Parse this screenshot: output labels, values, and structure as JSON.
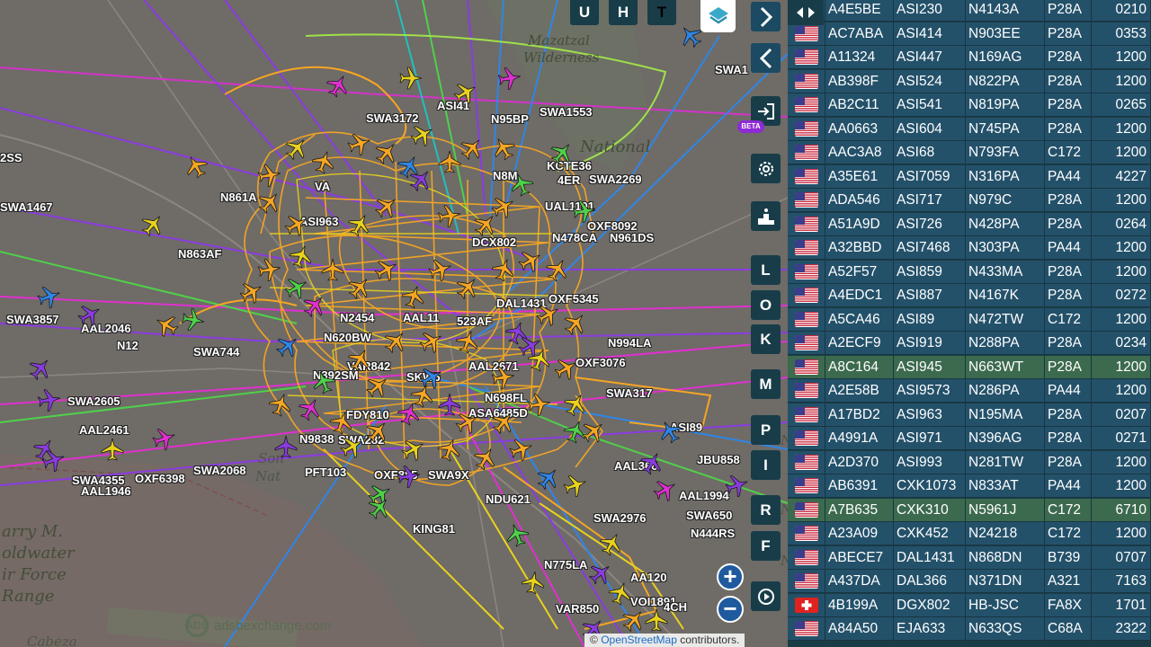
{
  "map": {
    "places": [
      "Mazatzal",
      "Wilderness",
      "National",
      "arry M.",
      "oldwater",
      "ir Force",
      "Range",
      "Son",
      "Nat",
      "Cabeza",
      "N",
      "N",
      "N"
    ],
    "callsigns": [
      "SWA3172",
      "ASI41",
      "N95BP",
      "SWA1553",
      "SWA1",
      "2SS",
      "SWA1467",
      "N861A",
      "ASI963",
      "N863AF",
      "KCTE36",
      "SWA2269",
      "OXF8092",
      "N961DS",
      "N478CA",
      "UAL1101",
      "DCX802",
      "SWA3857",
      "AAL2046",
      "N12",
      "SWA744",
      "N392SM",
      "VAR842",
      "SWA2605",
      "AAL2461",
      "SWA4355",
      "OXF6398",
      "AAL1946",
      "SWA2068",
      "PFT103",
      "FDY810",
      "SWA282",
      "N9838",
      "OXF885",
      "SWA9X",
      "N994LA",
      "OXF3076",
      "SWA317",
      "AAL2671",
      "N698FL",
      "ASA6485D",
      "JBU858",
      "AAL1994",
      "SWA650",
      "N444RS",
      "KING81",
      "N775LA",
      "AA120",
      "VOI1891",
      "VAR850",
      "SWA2976",
      "ASI89",
      "OXF5345",
      "N2454",
      "AAL11",
      "523AF",
      "VA",
      "NDU621",
      "N620BW",
      "SKW6",
      "DAL1431",
      "N8M",
      "4ER",
      "AAL366",
      "4CH"
    ],
    "logo_text": "adsbexchange.com",
    "logo_mark": "ADS",
    "attribution_prefix": "©",
    "attribution_link": "OpenStreetMap",
    "attribution_suffix": "contributors."
  },
  "controls": {
    "lang_u": "U",
    "lang_h": "H",
    "lang_t": "T",
    "next": "›",
    "prev": "‹",
    "beta": "BETA",
    "letters": [
      "L",
      "O",
      "K",
      "M",
      "P",
      "I",
      "R",
      "F"
    ],
    "zoom_in": "+",
    "zoom_out": "−"
  },
  "sidebar": {
    "toggle_icon": "◂▸",
    "rows": [
      {
        "flag": "US",
        "hex": "A4E5BE",
        "callsign": "ASI230",
        "reg": "N4143A",
        "type": "P28A",
        "alt": "0210"
      },
      {
        "flag": "US",
        "hex": "AC7ABA",
        "callsign": "ASI414",
        "reg": "N903EE",
        "type": "P28A",
        "alt": "0353"
      },
      {
        "flag": "US",
        "hex": "A11324",
        "callsign": "ASI447",
        "reg": "N169AG",
        "type": "P28A",
        "alt": "1200"
      },
      {
        "flag": "US",
        "hex": "AB398F",
        "callsign": "ASI524",
        "reg": "N822PA",
        "type": "P28A",
        "alt": "1200"
      },
      {
        "flag": "US",
        "hex": "AB2C11",
        "callsign": "ASI541",
        "reg": "N819PA",
        "type": "P28A",
        "alt": "0265"
      },
      {
        "flag": "US",
        "hex": "AA0663",
        "callsign": "ASI604",
        "reg": "N745PA",
        "type": "P28A",
        "alt": "1200"
      },
      {
        "flag": "US",
        "hex": "AAC3A8",
        "callsign": "ASI68",
        "reg": "N793FA",
        "type": "C172",
        "alt": "1200"
      },
      {
        "flag": "US",
        "hex": "A35E61",
        "callsign": "ASI7059",
        "reg": "N316PA",
        "type": "PA44",
        "alt": "4227"
      },
      {
        "flag": "US",
        "hex": "ADA546",
        "callsign": "ASI717",
        "reg": "N979C",
        "type": "P28A",
        "alt": "1200"
      },
      {
        "flag": "US",
        "hex": "A51A9D",
        "callsign": "ASI726",
        "reg": "N428PA",
        "type": "P28A",
        "alt": "0264"
      },
      {
        "flag": "US",
        "hex": "A32BBD",
        "callsign": "ASI7468",
        "reg": "N303PA",
        "type": "PA44",
        "alt": "1200"
      },
      {
        "flag": "US",
        "hex": "A52F57",
        "callsign": "ASI859",
        "reg": "N433MA",
        "type": "P28A",
        "alt": "1200"
      },
      {
        "flag": "US",
        "hex": "A4EDC1",
        "callsign": "ASI887",
        "reg": "N4167K",
        "type": "P28A",
        "alt": "0272"
      },
      {
        "flag": "US",
        "hex": "A5CA46",
        "callsign": "ASI89",
        "reg": "N472TW",
        "type": "C172",
        "alt": "1200"
      },
      {
        "flag": "US",
        "hex": "A2ECF9",
        "callsign": "ASI919",
        "reg": "N288PA",
        "type": "P28A",
        "alt": "0234"
      },
      {
        "flag": "US",
        "hex": "A8C164",
        "callsign": "ASI945",
        "reg": "N663WT",
        "type": "P28A",
        "alt": "1200",
        "hl": true
      },
      {
        "flag": "US",
        "hex": "A2E58B",
        "callsign": "ASI9573",
        "reg": "N286PA",
        "type": "PA44",
        "alt": "1200"
      },
      {
        "flag": "US",
        "hex": "A17BD2",
        "callsign": "ASI963",
        "reg": "N195MA",
        "type": "P28A",
        "alt": "0207"
      },
      {
        "flag": "US",
        "hex": "A4991A",
        "callsign": "ASI971",
        "reg": "N396AG",
        "type": "P28A",
        "alt": "0271"
      },
      {
        "flag": "US",
        "hex": "A2D370",
        "callsign": "ASI993",
        "reg": "N281TW",
        "type": "P28A",
        "alt": "1200"
      },
      {
        "flag": "US",
        "hex": "AB6391",
        "callsign": "CXK1073",
        "reg": "N833AT",
        "type": "PA44",
        "alt": "1200"
      },
      {
        "flag": "US",
        "hex": "A7B635",
        "callsign": "CXK310",
        "reg": "N5961J",
        "type": "C172",
        "alt": "6710",
        "hl": true
      },
      {
        "flag": "US",
        "hex": "A23A09",
        "callsign": "CXK452",
        "reg": "N24218",
        "type": "C172",
        "alt": "1200"
      },
      {
        "flag": "US",
        "hex": "ABECE7",
        "callsign": "DAL1431",
        "reg": "N868DN",
        "type": "B739",
        "alt": "0707"
      },
      {
        "flag": "US",
        "hex": "A437DA",
        "callsign": "DAL366",
        "reg": "N371DN",
        "type": "A321",
        "alt": "7163"
      },
      {
        "flag": "CH",
        "hex": "4B199A",
        "callsign": "DGX802",
        "reg": "HB-JSC",
        "type": "FA8X",
        "alt": "1701"
      },
      {
        "flag": "US",
        "hex": "A84A50",
        "callsign": "EJA633",
        "reg": "N633QS",
        "type": "C68A",
        "alt": "2322"
      }
    ]
  },
  "colors": {
    "sidebar_bg": "#1a3c47",
    "cell_bg": "#24516a",
    "highlight_bg": "#3c6a4e",
    "map_bg": "#6e6a66",
    "track_orange": "#f5a623",
    "track_yellow": "#e8d21d",
    "track_purple": "#8a3ce0",
    "track_magenta": "#e030d0",
    "track_blue": "#2f86e6",
    "track_green": "#4fd04a",
    "control_bg": "#183d49"
  },
  "icons": [
    "airplane-icon",
    "layers-icon",
    "login-icon",
    "gear-icon",
    "podium-icon",
    "replay-icon",
    "chevron-right-icon",
    "chevron-left-icon",
    "flag-us-icon",
    "flag-ch-icon"
  ]
}
